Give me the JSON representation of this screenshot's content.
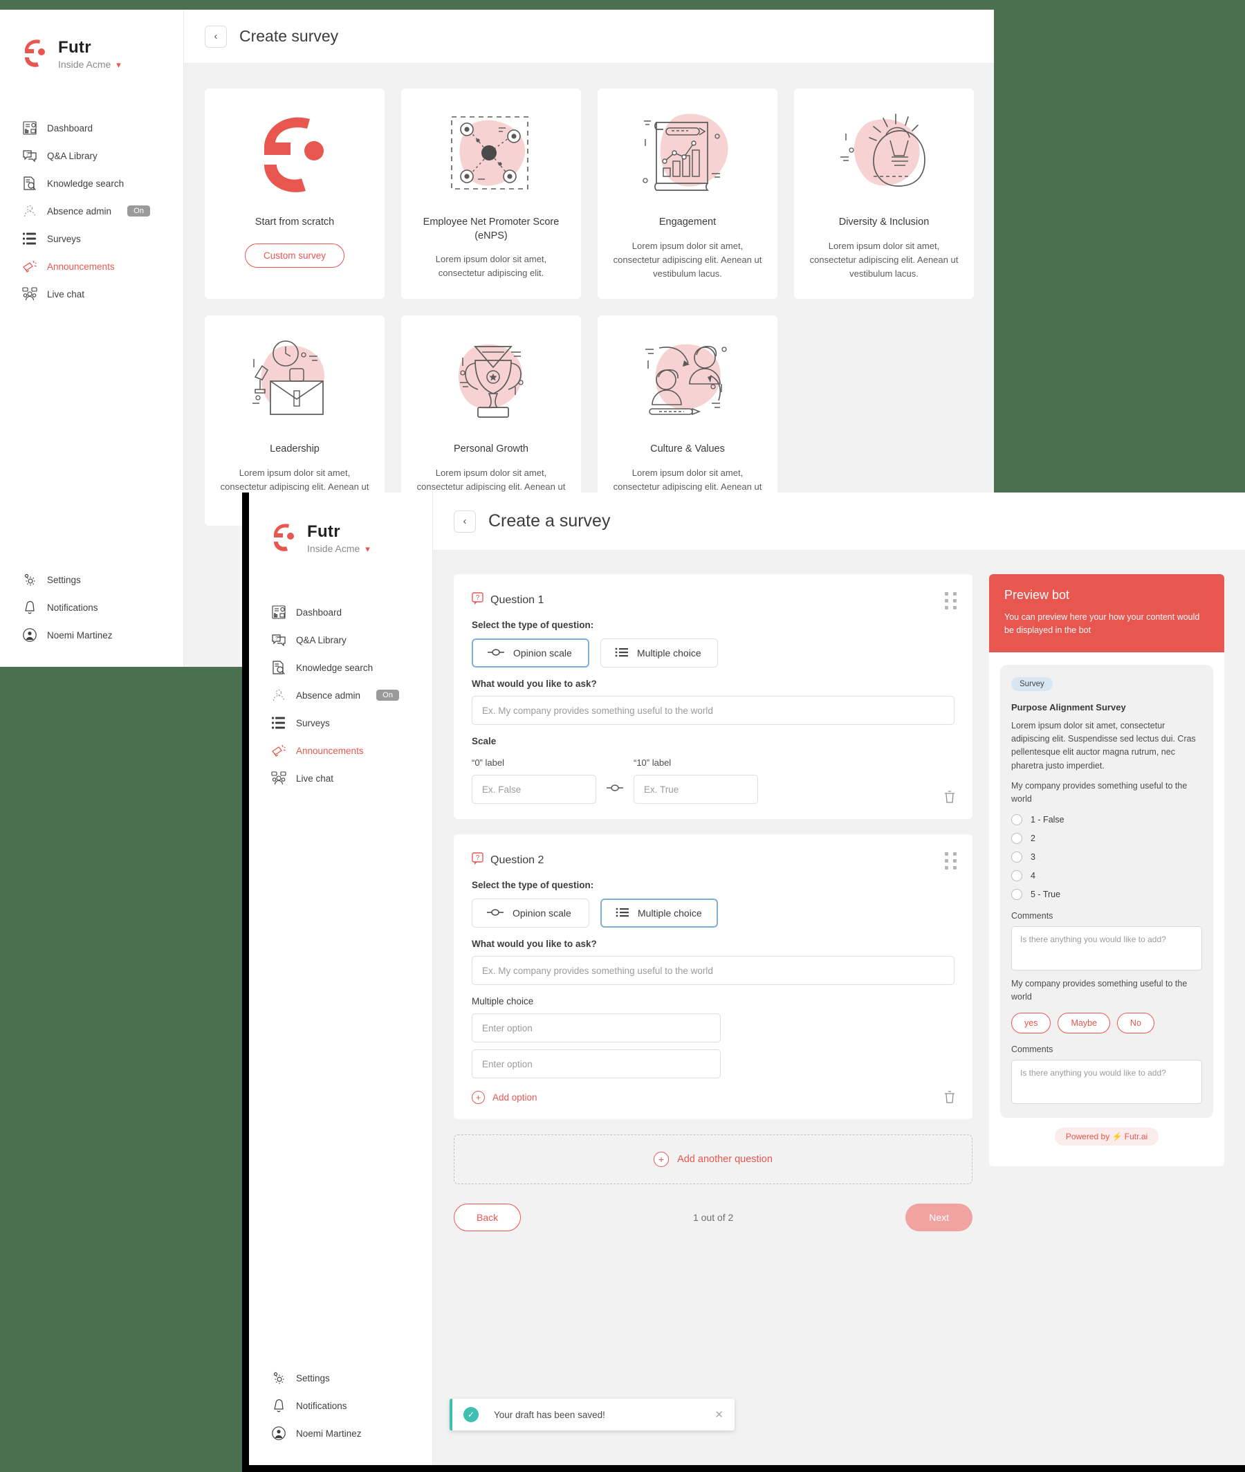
{
  "brand": {
    "name": "Futr",
    "workspace": "Inside Acme"
  },
  "sidebar": {
    "items": [
      {
        "label": "Dashboard",
        "icon": "dashboard-icon"
      },
      {
        "label": "Q&A Library",
        "icon": "qa-library-icon"
      },
      {
        "label": "Knowledge search",
        "icon": "knowledge-search-icon"
      },
      {
        "label": "Absence admin",
        "icon": "absence-admin-icon",
        "badge": "On"
      },
      {
        "label": "Surveys",
        "icon": "surveys-icon"
      },
      {
        "label": "Announcements",
        "icon": "announcements-icon",
        "active": true
      },
      {
        "label": "Live chat",
        "icon": "live-chat-icon"
      }
    ],
    "bottom_items": [
      {
        "label": "Settings",
        "icon": "gear-icon"
      },
      {
        "label": "Notifications",
        "icon": "bell-icon"
      },
      {
        "label": "Noemi Martinez",
        "icon": "avatar-icon"
      }
    ]
  },
  "window1": {
    "title": "Create survey",
    "back_icon": "chevron-left-icon",
    "templates": [
      {
        "title": "Start from scratch",
        "desc": "",
        "button": "Custom survey",
        "art": "futr-logo-art"
      },
      {
        "title": "Employee Net Promoter Score (eNPS)",
        "desc": "Lorem ipsum dolor sit amet, consectetur adipiscing elit.",
        "art": "network-art"
      },
      {
        "title": "Engagement",
        "desc": "Lorem ipsum dolor sit amet, consectetur adipiscing elit. Aenean ut vestibulum lacus.",
        "art": "chart-scroll-art"
      },
      {
        "title": "Diversity & Inclusion",
        "desc": "Lorem ipsum dolor sit amet, consectetur adipiscing elit. Aenean ut vestibulum lacus.",
        "art": "lightbulb-head-art"
      },
      {
        "title": "Leadership",
        "desc": "Lorem ipsum dolor sit amet, consectetur adipiscing elit. Aenean ut vestibulum lacus.",
        "art": "briefcase-art"
      },
      {
        "title": "Personal Growth",
        "desc": "Lorem ipsum dolor sit amet, consectetur adipiscing elit. Aenean ut vestibulum lacus.",
        "art": "trophy-art"
      },
      {
        "title": "Culture & Values",
        "desc": "Lorem ipsum dolor sit amet, consectetur adipiscing elit. Aenean ut vestibulum lacus.",
        "art": "people-art"
      }
    ]
  },
  "window2": {
    "title": "Create a survey",
    "back_icon": "chevron-left-icon",
    "type_label": "Select the type of question:",
    "ask_label": "What would you like to ask?",
    "ask_placeholder": "Ex. My company provides something useful to the world",
    "type_opinion": "Opinion scale",
    "type_multiple": "Multiple choice",
    "questions": [
      {
        "title": "Question 1",
        "selected_type": "Opinion scale",
        "scale_label": "Scale",
        "low_label": "“0” label",
        "high_label": "“10” label",
        "low_placeholder": "Ex. False",
        "high_placeholder": "Ex. True"
      },
      {
        "title": "Question 2",
        "selected_type": "Multiple choice",
        "choice_label": "Multiple choice",
        "option_placeholder": "Enter option",
        "options_count": 2,
        "add_option": "Add option"
      }
    ],
    "add_question": "Add another question",
    "back_button": "Back",
    "page_indicator": "1 out of 2",
    "next_button": "Next"
  },
  "preview": {
    "heading": "Preview bot",
    "subtext": "You can preview here your how your content would be displayed in the bot",
    "chip": "Survey",
    "survey_title": "Purpose Alignment Survey",
    "survey_desc": "Lorem ipsum dolor sit amet, consectetur adipiscing elit. Suspendisse sed lectus dui. Cras pellentesque elit auctor magna rutrum, nec pharetra justo imperdiet.",
    "q1_text": "My company provides something useful to the world",
    "q1_options": [
      "1 - False",
      "2",
      "3",
      "4",
      "5 - True"
    ],
    "comments_label_1": "Comments",
    "comments_placeholder_1": "Is there anything you would like to add?",
    "q2_text": "My company provides something useful to the world",
    "q2_pills": [
      "yes",
      "Maybe",
      "No"
    ],
    "comments_label_2": "Comments",
    "comments_placeholder_2": "Is there anything you would like to add?",
    "powered_by": "Powered by ⚡ Futr.ai"
  },
  "toast": {
    "message": "Your draft has been saved!",
    "close_icon": "close-icon"
  },
  "colors": {
    "accent": "#e8574f",
    "accent_soft": "#f0a3a0",
    "pink_art": "#f7d2d2",
    "success": "#3fbfb0",
    "chip_blue": "#d6e7f3",
    "desktop_bg": "#4a7050"
  }
}
